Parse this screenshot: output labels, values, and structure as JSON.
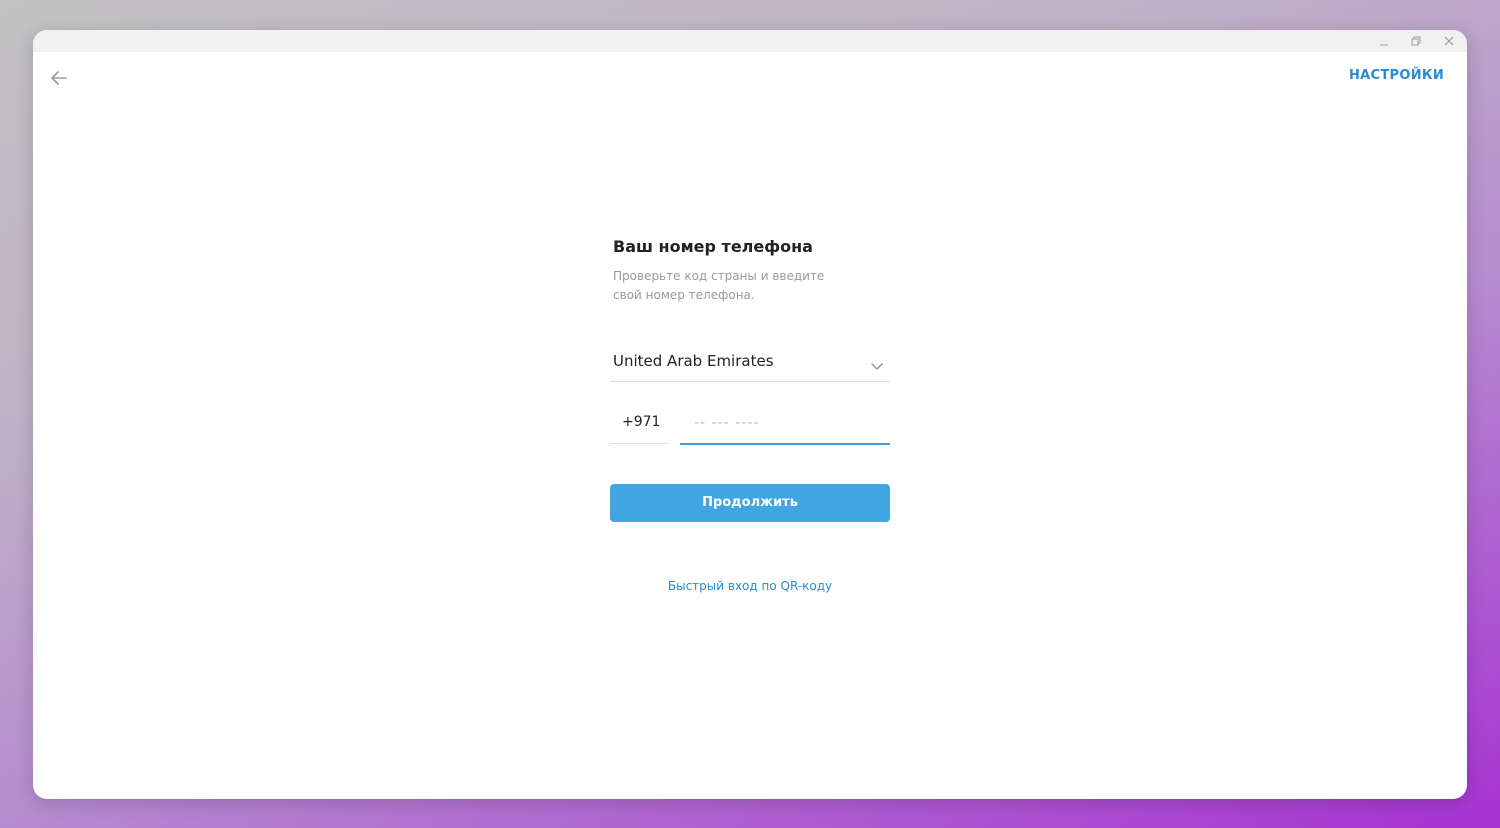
{
  "window": {
    "controls": {
      "minimize_icon": "minimize-icon",
      "maximize_icon": "restore-icon",
      "close_icon": "close-icon"
    }
  },
  "header": {
    "back_icon": "arrow-left-icon",
    "settings_label": "НАСТРОЙКИ"
  },
  "login": {
    "title": "Ваш номер телефона",
    "subtitle": "Проверьте код страны и введите свой номер телефона.",
    "country": {
      "selected": "United Arab Emirates",
      "icon": "chevron-down-icon"
    },
    "phone": {
      "code": "+971",
      "value": "",
      "placeholder": "-- --- ----"
    },
    "continue_label": "Продолжить",
    "qr_link_label": "Быстрый вход по QR-коду"
  },
  "colors": {
    "accent": "#40a6e2",
    "link": "#2a8ad4",
    "input_focus": "#3b9edc",
    "text_primary": "#222222",
    "text_secondary": "#9a9a9a"
  }
}
